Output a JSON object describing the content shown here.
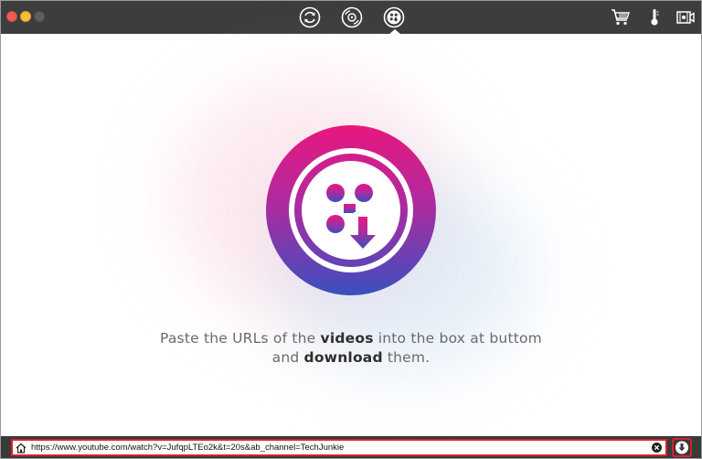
{
  "window": {
    "controls": [
      "close",
      "minimize",
      "maximize"
    ]
  },
  "toolbar": {
    "tabs": [
      {
        "icon": "convert-icon",
        "active": false
      },
      {
        "icon": "burn-disc-icon",
        "active": false
      },
      {
        "icon": "download-video-icon",
        "active": true
      }
    ],
    "right_icons": [
      "cart-icon",
      "thermometer-icon",
      "video-settings-icon"
    ]
  },
  "main": {
    "caption_line1_pre": "Paste the URLs of the ",
    "caption_line1_bold": "videos",
    "caption_line1_post": " into the box at buttom",
    "caption_line2_pre": "and ",
    "caption_line2_bold": "download",
    "caption_line2_post": " them."
  },
  "url_bar": {
    "value": "https://www.youtube.com/watch?v=JufqpLTEo2k&t=20s&ab_channel=TechJunkie"
  },
  "colors": {
    "titlebar": "#3d3d3d",
    "accent_border": "#d91f2a",
    "logo_gradient_top": "#e8177e",
    "logo_gradient_bottom": "#3a4fc0"
  }
}
